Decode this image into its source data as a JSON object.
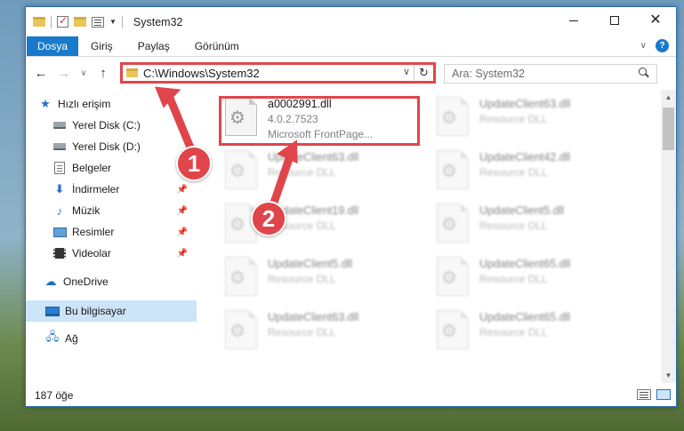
{
  "window": {
    "title": "System32"
  },
  "ribbon": {
    "tabs": [
      "Dosya",
      "Giriş",
      "Paylaş",
      "Görünüm"
    ]
  },
  "address": {
    "path": "C:\\Windows\\System32",
    "search_placeholder": "Ara: System32"
  },
  "nav": {
    "items": [
      {
        "label": "Hızlı erişim",
        "icon": "star-icon"
      },
      {
        "label": "Yerel Disk (C:)",
        "icon": "disk-icon"
      },
      {
        "label": "Yerel Disk (D:)",
        "icon": "disk-icon"
      },
      {
        "label": "Belgeler",
        "icon": "documents-icon"
      },
      {
        "label": "İndirmeler",
        "icon": "downloads-icon"
      },
      {
        "label": "Müzik",
        "icon": "music-icon"
      },
      {
        "label": "Resimler",
        "icon": "pictures-icon"
      },
      {
        "label": "Videolar",
        "icon": "videos-icon"
      },
      {
        "label": "OneDrive",
        "icon": "cloud-icon"
      },
      {
        "label": "Bu bilgisayar",
        "icon": "pc-icon"
      },
      {
        "label": "Ağ",
        "icon": "network-icon"
      }
    ],
    "pinned": [
      "•",
      "•",
      "•"
    ]
  },
  "files": {
    "main": {
      "name": "a0002991.dll",
      "version": "4.0.2.7523",
      "description": "Microsoft FrontPage..."
    },
    "blurred": [
      {
        "name": "UpdateClient63.dll",
        "type": "Resource DLL"
      },
      {
        "name": "UpdateClient63.dll",
        "type": "Resource DLL"
      },
      {
        "name": "UpdateClient42.dll",
        "type": "Resource DLL"
      },
      {
        "name": "UpdateClient19.dll",
        "type": "Resource DLL"
      },
      {
        "name": "UpdateClient5.dll",
        "type": "Resource DLL"
      },
      {
        "name": "UpdateClient5.dll",
        "type": "Resource DLL"
      },
      {
        "name": "UpdateClient65.dll",
        "type": "Resource DLL"
      },
      {
        "name": "UpdateClient63.dll",
        "type": "Resource DLL"
      },
      {
        "name": "UpdateClient65.dll",
        "type": "Resource DLL"
      }
    ]
  },
  "status": {
    "count": "187 öğe"
  },
  "annotations": {
    "step1": "1",
    "step2": "2",
    "color": "#e0454b"
  }
}
